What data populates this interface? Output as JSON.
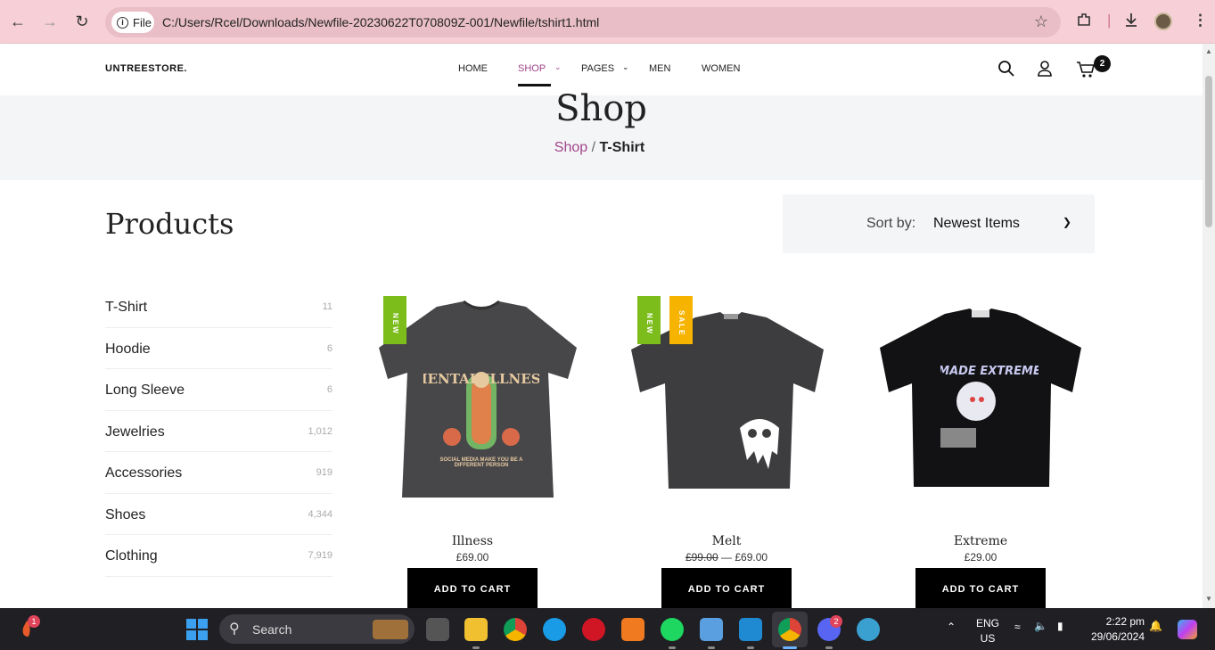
{
  "browser": {
    "page_info_label": "File",
    "url": "C:/Users/Rcel/Downloads/Newfile-20230622T070809Z-001/Newfile/tshirt1.html"
  },
  "site": {
    "logo": "UNTREESTORE.",
    "menu": [
      "HOME",
      "SHOP",
      "PAGES",
      "MEN",
      "WOMEN"
    ],
    "active_menu": "SHOP",
    "cart_count": "2",
    "accent_color": "#a0458a"
  },
  "page_header": {
    "title": "Shop",
    "breadcrumb_link": "Shop",
    "breadcrumb_sep": "/",
    "breadcrumb_current": "T-Shirt"
  },
  "products_section": {
    "title": "Products",
    "sort_label": "Sort by:",
    "sort_value": "Newest Items"
  },
  "categories": [
    {
      "name": "T-Shirt",
      "count": "11"
    },
    {
      "name": "Hoodie",
      "count": "6"
    },
    {
      "name": "Long Sleeve",
      "count": "6"
    },
    {
      "name": "Jewelries",
      "count": "1,012"
    },
    {
      "name": "Accessories",
      "count": "919"
    },
    {
      "name": "Shoes",
      "count": "4,344"
    },
    {
      "name": "Clothing",
      "count": "7,919"
    }
  ],
  "products": [
    {
      "name": "Illness",
      "price": "£69.00",
      "old_price": "",
      "tags": [
        "NEW"
      ],
      "button": "ADD TO CART",
      "print_text": "MENTAL ILLNESS",
      "print_sub": "SOCIAL MEDIA MAKE YOU BE A DIFFERENT PERSON"
    },
    {
      "name": "Melt",
      "price": "£69.00",
      "old_price": "£99.00",
      "price_sep": "—",
      "tags": [
        "NEW",
        "SALE"
      ],
      "button": "ADD TO CART"
    },
    {
      "name": "Extreme",
      "price": "£29.00",
      "old_price": "",
      "tags": [],
      "button": "ADD TO CART",
      "print_text": "MADE EXTREME"
    }
  ],
  "taskbar": {
    "search_label": "Search",
    "lang_top": "ENG",
    "lang_bottom": "US",
    "time": "2:22 pm",
    "date": "29/06/2024",
    "left_badge": "1",
    "discord_badge": "2"
  }
}
